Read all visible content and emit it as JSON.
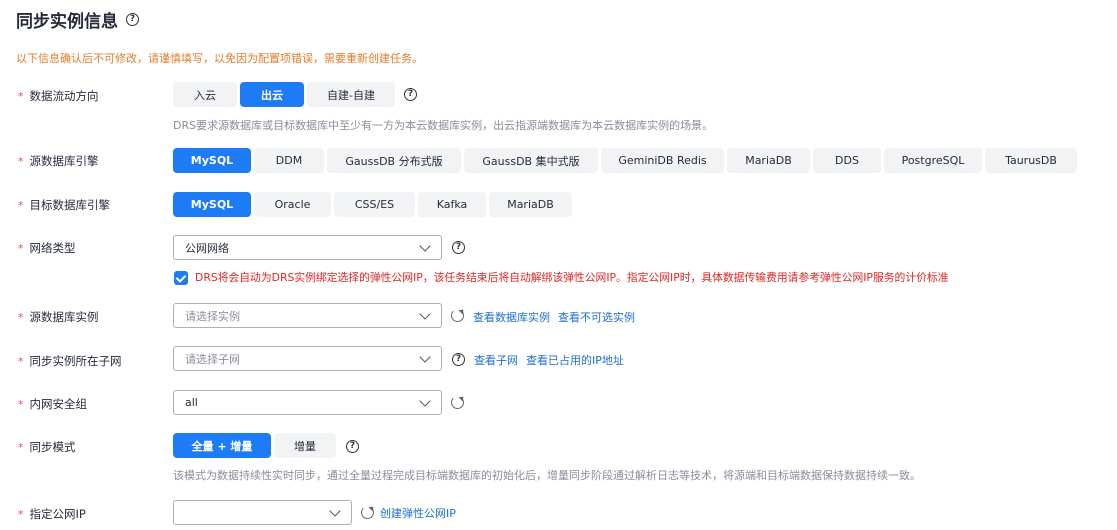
{
  "page": {
    "title": "同步实例信息",
    "notice": "以下信息确认后不可修改，请谨慎填写，以免因为配置项错误，需要重新创建任务。"
  },
  "flow": {
    "label": "数据流动方向",
    "options": [
      "入云",
      "出云",
      "自建-自建"
    ],
    "selected": "出云",
    "hint": "DRS要求源数据库或目标数据库中至少有一方为本云数据库实例，出云指源端数据库为本云数据库实例的场景。"
  },
  "source_engine": {
    "label": "源数据库引擎",
    "options": [
      "MySQL",
      "DDM",
      "GaussDB 分布式版",
      "GaussDB 集中式版",
      "GeminiDB Redis",
      "MariaDB",
      "DDS",
      "PostgreSQL",
      "TaurusDB"
    ],
    "selected": "MySQL"
  },
  "target_engine": {
    "label": "目标数据库引擎",
    "options": [
      "MySQL",
      "Oracle",
      "CSS/ES",
      "Kafka",
      "MariaDB"
    ],
    "selected": "MySQL"
  },
  "network": {
    "label": "网络类型",
    "value": "公网网络",
    "checkbox_checked": true,
    "checkbox_text": "DRS将会自动为DRS实例绑定选择的弹性公网IP，该任务结束后将自动解绑该弹性公网IP。指定公网IP时，具体数据传输费用请参考弹性公网IP服务的计价标准"
  },
  "source_instance": {
    "label": "源数据库实例",
    "placeholder": "请选择实例",
    "links": [
      "查看数据库实例",
      "查看不可选实例"
    ]
  },
  "subnet": {
    "label": "同步实例所在子网",
    "placeholder": "请选择子网",
    "links": [
      "查看子网",
      "查看已占用的IP地址"
    ]
  },
  "security_group": {
    "label": "内网安全组",
    "value": "all"
  },
  "sync_mode": {
    "label": "同步模式",
    "options": [
      "全量 + 增量",
      "增量"
    ],
    "selected": "全量 + 增量",
    "hint": "该模式为数据持续性实时同步，通过全量过程完成目标端数据库的初始化后，增量同步阶段通过解析日志等技术，将源端和目标端数据保持数据持续一致。"
  },
  "public_ip": {
    "label": "指定公网IP",
    "value": "",
    "link": "创建弹性公网IP"
  },
  "common": {
    "required_mark": "*",
    "help_glyph": "?"
  }
}
